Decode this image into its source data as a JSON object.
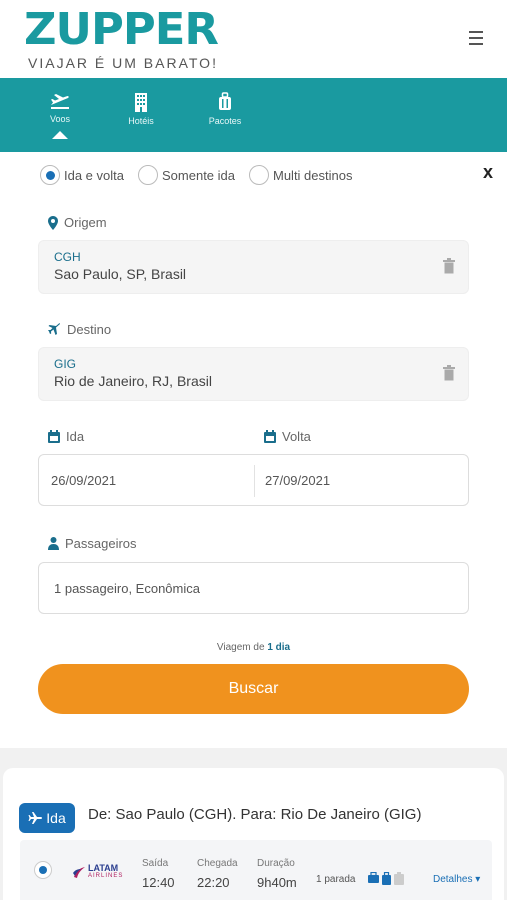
{
  "header": {
    "logo_text": "ZUPPER",
    "tagline": "VIAJAR É UM BARATO!",
    "menu_icon": "hamburger-icon"
  },
  "nav": {
    "items": [
      {
        "label": "Voos",
        "icon": "airplane-takeoff-icon",
        "active": true
      },
      {
        "label": "Hotéis",
        "icon": "building-icon"
      },
      {
        "label": "Pacotes",
        "icon": "suitcase-icon"
      }
    ]
  },
  "search": {
    "trip_types": [
      "Ida e volta",
      "Somente ida",
      "Multi destinos"
    ],
    "selected_trip_type": "Ida e volta",
    "origin": {
      "label": "Origem",
      "code": "CGH",
      "name": "Sao Paulo, SP, Brasil"
    },
    "destination": {
      "label": "Destino",
      "code": "GIG",
      "name": "Rio de Janeiro, RJ, Brasil"
    },
    "departure": {
      "label": "Ida",
      "value": "26/09/2021"
    },
    "return": {
      "label": "Volta",
      "value": "27/09/2021"
    },
    "passengers": {
      "label": "Passageiros",
      "value": "1 passageiro, Econômica"
    },
    "trip_note_prefix": "Viagem de",
    "trip_note_duration": "1 dia",
    "submit_label": "Buscar",
    "close_label": "x"
  },
  "result": {
    "direction_label": "Ida",
    "route": "De: Sao Paulo (CGH). Para: Rio De Janeiro (GIG)",
    "flight": {
      "airline": "LATAM",
      "airline_sub": "AIRLINES",
      "departure_header": "Saída",
      "departure_time": "12:40",
      "arrival_header": "Chegada",
      "arrival_time": "22:20",
      "duration_header": "Duração",
      "duration": "9h40m",
      "stops": "1 parada",
      "details_label": "Detalhes ▾"
    }
  },
  "colors": {
    "brand_teal": "#1a9aa0",
    "accent_orange": "#f0921e",
    "link_blue": "#1a6fb5"
  }
}
